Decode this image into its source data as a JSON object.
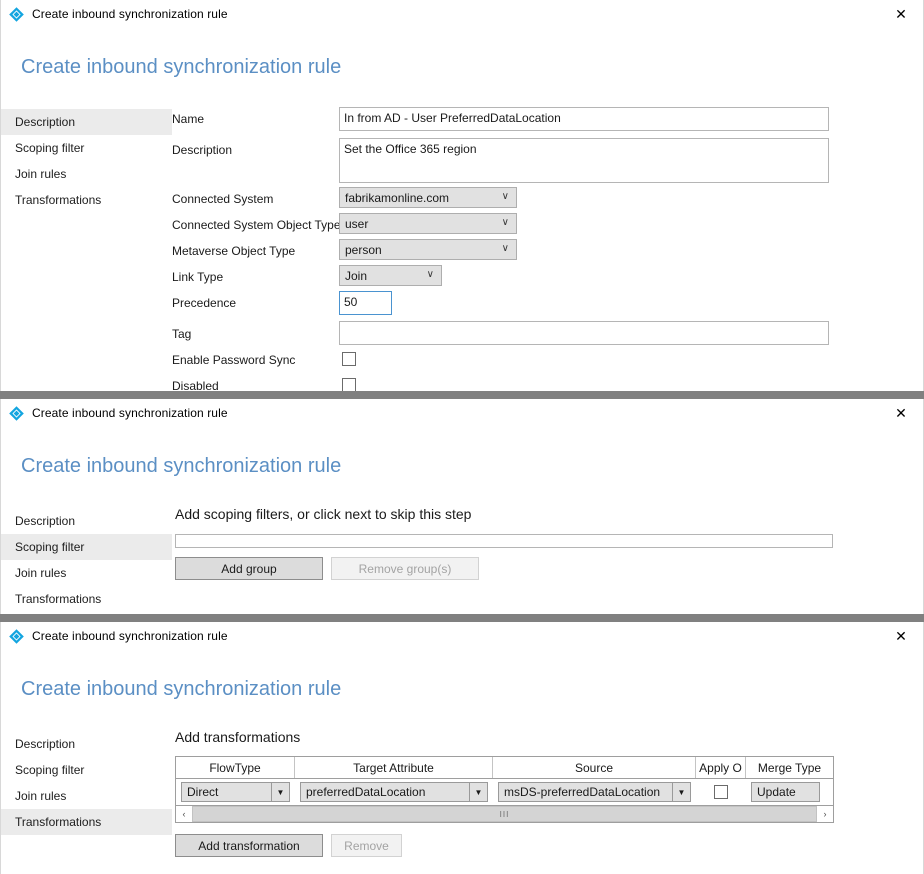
{
  "window": {
    "title": "Create inbound synchronization rule",
    "heading": "Create inbound synchronization rule",
    "close_label": "✕",
    "app_icon": "diamond-icon",
    "accent_color": "#5b8fc4",
    "icon_color": "#13a5e0"
  },
  "nav": {
    "items": [
      {
        "label": "Description"
      },
      {
        "label": "Scoping filter"
      },
      {
        "label": "Join rules"
      },
      {
        "label": "Transformations"
      }
    ]
  },
  "panel1": {
    "selected_nav": "Description",
    "fields": {
      "name_label": "Name",
      "name_value": "In from AD - User PreferredDataLocation",
      "description_label": "Description",
      "description_value": "Set the Office 365 region",
      "connected_system_label": "Connected System",
      "connected_system_value": "fabrikamonline.com",
      "connected_system_object_type_label": "Connected System Object Type",
      "connected_system_object_type_value": "user",
      "metaverse_object_type_label": "Metaverse Object Type",
      "metaverse_object_type_value": "person",
      "link_type_label": "Link Type",
      "link_type_value": "Join",
      "precedence_label": "Precedence",
      "precedence_value": "50",
      "tag_label": "Tag",
      "tag_value": "",
      "enable_password_sync_label": "Enable Password Sync",
      "enable_password_sync_checked": false,
      "disabled_label": "Disabled",
      "disabled_checked": false
    },
    "chevron": "∨"
  },
  "panel2": {
    "selected_nav": "Scoping filter",
    "section_heading": "Add scoping filters, or click next to skip this step",
    "add_group_label": "Add group",
    "remove_groups_label": "Remove group(s)",
    "remove_groups_enabled": false
  },
  "panel3": {
    "selected_nav": "Transformations",
    "section_heading": "Add transformations",
    "table": {
      "columns": [
        "FlowType",
        "Target Attribute",
        "Source",
        "Apply O",
        "Merge Type"
      ],
      "rows": [
        {
          "flow_type": "Direct",
          "target_attribute": "preferredDataLocation",
          "source": "msDS-preferredDataLocation",
          "apply_once": false,
          "merge_type": "Update"
        }
      ]
    },
    "scrollbar": {
      "left_arrow": "‹",
      "right_arrow": "›",
      "grip": "III"
    },
    "add_transformation_label": "Add transformation",
    "remove_label": "Remove",
    "remove_enabled": false,
    "dropdown_arrow": "▼"
  }
}
